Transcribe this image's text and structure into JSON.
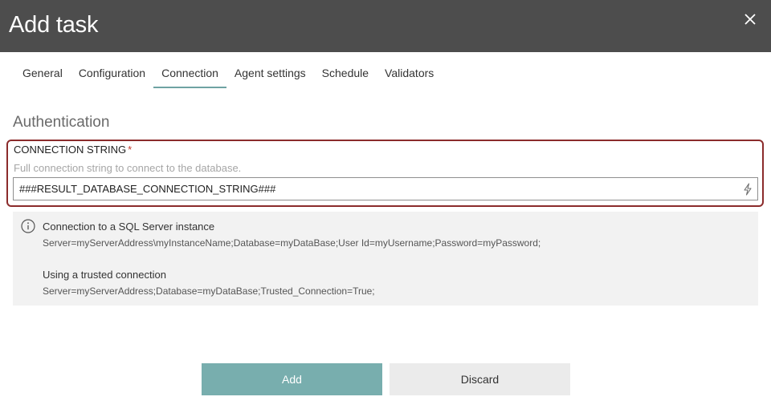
{
  "header": {
    "title": "Add task",
    "close_icon": "close-icon"
  },
  "tabs": [
    {
      "label": "General",
      "active": false
    },
    {
      "label": "Configuration",
      "active": false
    },
    {
      "label": "Connection",
      "active": true
    },
    {
      "label": "Agent settings",
      "active": false
    },
    {
      "label": "Schedule",
      "active": false
    },
    {
      "label": "Validators",
      "active": false
    }
  ],
  "section": {
    "title": "Authentication"
  },
  "connection_field": {
    "label": "CONNECTION STRING",
    "required_marker": "*",
    "help": "Full connection string to connect to the database.",
    "value": "###RESULT_DATABASE_CONNECTION_STRING###",
    "action_icon": "lightning-icon"
  },
  "info": {
    "icon": "info-icon",
    "examples": [
      {
        "heading": "Connection to a SQL Server instance",
        "code": "Server=myServerAddress\\myInstanceName;Database=myDataBase;User Id=myUsername;Password=myPassword;"
      },
      {
        "heading": "Using a trusted connection",
        "code": "Server=myServerAddress;Database=myDataBase;Trusted_Connection=True;"
      }
    ]
  },
  "actions": {
    "add_label": "Add",
    "discard_label": "Discard"
  },
  "colors": {
    "header_bg": "#4d4d4d",
    "accent": "#78aeae",
    "error_border": "#8b2b2b",
    "required": "#c0392b"
  }
}
